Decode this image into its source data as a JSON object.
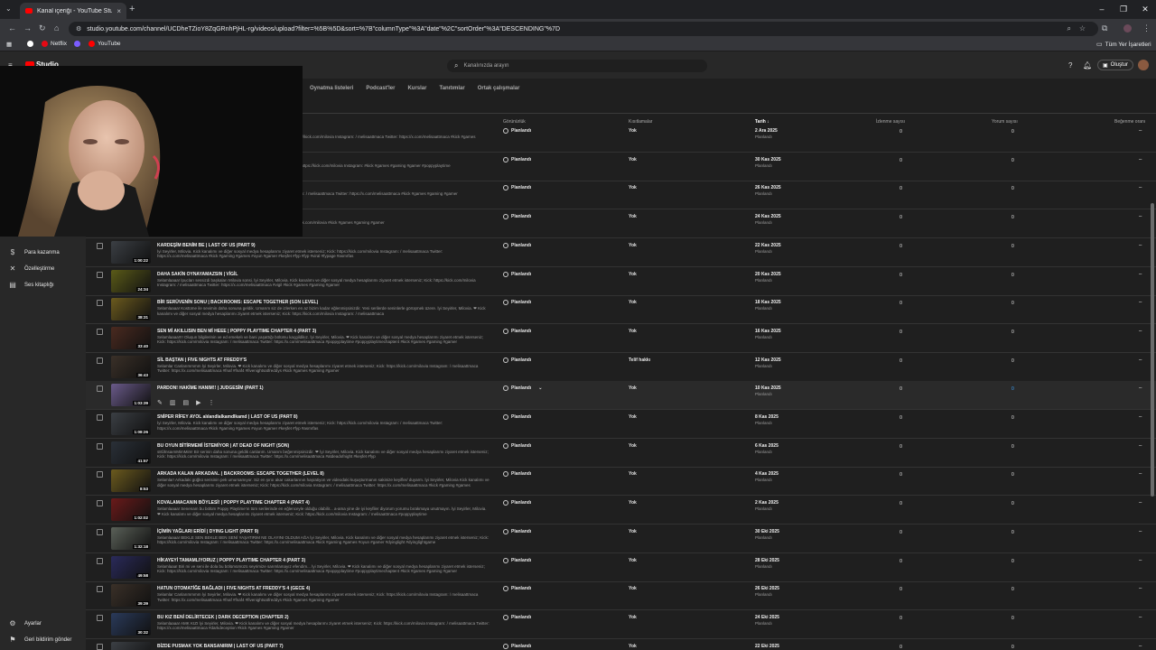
{
  "browser": {
    "tab_title": "Kanal içeriği - YouTube Studio",
    "url": "studio.youtube.com/channel/UCDheTZioY8ZqGRnhPjHL-rg/videos/upload?filter=%5B%5D&sort=%7B\"columnType\"%3A\"date\"%2C\"sortOrder\"%3A\"DESCENDING\"%7D",
    "bookmarks": [
      "Netflix",
      "YouTube"
    ],
    "all_bookmarks": "Tüm Yer İşaretleri"
  },
  "header": {
    "logo": "Studio",
    "search_placeholder": "Kanalınızda arayın",
    "create_label": "Oluştur"
  },
  "sidebar": {
    "items": [
      {
        "label": "Para kazanma",
        "icon": "dollar-icon"
      },
      {
        "label": "Özelleştirme",
        "icon": "brush-icon"
      },
      {
        "label": "Ses kitaplığı",
        "icon": "music-icon"
      }
    ],
    "bottom": [
      {
        "label": "Ayarlar",
        "icon": "gear-icon"
      },
      {
        "label": "Geri bildirim gönder",
        "icon": "feedback-icon"
      }
    ]
  },
  "tabs": [
    "Oynatma listeleri",
    "Podcast'ler",
    "Kurslar",
    "Tanıtımlar",
    "Ortak çalışmalar"
  ],
  "columns": {
    "visibility": "Görünürlük",
    "restrictions": "Kısıtlamalar",
    "date": "Tarih ↓",
    "views": "İzlenme sayısı",
    "comments": "Yorum sayısı",
    "likes": "Beğenme oranı"
  },
  "colors": {
    "accent_blue": "#3ea6ff",
    "bg": "#1f1f1f",
    "sidebar": "#282828"
  },
  "rows": [
    {
      "title": "",
      "desc": "kanalımı ve diğer sosyal medya hesaplarımı ziyaret etmek isterseniz; Kick: https://kick.com/milovia Instagram: / melisaattmaca Twitter: https://x.com/melisaattmaca #kick #games #gaming #gamer",
      "duration": "",
      "visibility": "Planlandı",
      "restriction": "Yok",
      "date": "2 Ara 2025",
      "status": "Planlandı",
      "views": "0",
      "comments": "0",
      "likes": "–",
      "thumb": "#000000"
    },
    {
      "title": "",
      "desc": "Kick kanalımı ve diğer sosyal medya hesaplarımı ziyaret etmek isterseniz; Kick: https://kick.com/milovia Instagram: #kick #games #gaming #gamer #poppyplaytime",
      "duration": "",
      "visibility": "Planlandı",
      "restriction": "Yok",
      "date": "30 Kas 2025",
      "status": "Planlandı",
      "views": "0",
      "comments": "0",
      "likes": "–",
      "thumb": "#000000"
    },
    {
      "title": "",
      "desc": "diya hesaplarımı ziyaret etmek isterseniz; Kick: https://kick.com/milovia Instagram: / melisaattmaca Twitter: https://x.com/melisaattmaca #kick #games #gaming #gamer",
      "duration": "",
      "visibility": "Planlandı",
      "restriction": "Yok",
      "date": "26 Kas 2025",
      "status": "Planlandı",
      "views": "0",
      "comments": "0",
      "likes": "–",
      "thumb": "#000000"
    },
    {
      "title": "",
      "desc": "ialini ve diğer sosyal medya hesaplarımı ziyaret etmek isterseniz; Kick: https://kick.com/milovia #kick #games #gaming #gamer",
      "duration": "",
      "visibility": "Planlandı",
      "restriction": "Yok",
      "date": "24 Kas 2025",
      "status": "Planlandı",
      "views": "0",
      "comments": "0",
      "likes": "–",
      "thumb": "#000000"
    },
    {
      "title": "KARDEŞİM BENİM BE | LAST OF US (PART 9)",
      "desc": "İyi Seyirler, Milovia. Kick kanalımı ve diğer sosyal medya hesaplarımı ziyaret etmek isterseniz; Kick: https://kick.com/milovia Instagram: / melisaattmaca Twitter: https://x.com/melisaattmaca #kick #gaming #games #oyun #gamer #keşfet #fyp #fyp #viral #fypage #asmrfas",
      "duration": "1:00:22",
      "visibility": "Planlandı",
      "restriction": "Yok",
      "date": "22 Kas 2025",
      "status": "Planlandı",
      "views": "0",
      "comments": "0",
      "likes": "–",
      "thumb": "#3b3f44"
    },
    {
      "title": "DAHA SAKİN OYNAYAMAZSIN | VİGİL",
      "desc": "Selamlaaaa! İpucları sessizdi başkaları Milovia sonsi. İyi Seyirler, Milovia. Kick kanalımı ve diğer sosyal medya hesaplarımı ziyaret etmek isterseniz; Kick: https://kick.com/milovia Instagram: / melisaattmaca Twitter: https://x.com/melisaattmaca #vigil #kick #games #gaming #gamer",
      "duration": "24:34",
      "visibility": "Planlandı",
      "restriction": "Yok",
      "date": "20 Kas 2025",
      "status": "Planlandı",
      "views": "0",
      "comments": "0",
      "likes": "–",
      "thumb": "#5a5a18"
    },
    {
      "title": "BİR SERÜVENİN SONU | BACKROOMS: ESCAPE TOGETHER (SON LEVEL)",
      "desc": "Selamlaaaa! Kostüme ile sevimin daha sonuna geldik. Umarım siz de izlerken en az bizim kadar eğlenmişsinizdir. Yeni serilerde seninlerle görüşmek üzere. İyi Seyirler, Milovia. ❤ Kick kanalımı ve diğer sosyal medya hesaplarımı ziyaret etmek isterseniz; Kick: https://kick.com/milovia Instagram: / melisaattmaca",
      "duration": "38:31",
      "visibility": "Planlandı",
      "restriction": "Yok",
      "date": "18 Kas 2025",
      "status": "Planlandı",
      "views": "0",
      "comments": "0",
      "likes": "–",
      "thumb": "#6b5a1e"
    },
    {
      "title": "SEN Mİ AKILLISIN BEN Mİ HEEE | POPPY PLAYTIME CHAPTER 4 (PART 3)",
      "desc": "Selamlaaaa!!!! Oluşun bilgilerinin ve ed emekelı ve bani yaşattığı bölümu kaçgildikız. İyi Seyirler, Milovia. ❤ Kick kanalımı ve diğer sosyal medya hesaplarımı ziyaret etmek isterseniz; Kick: https://kick.com/milovia Instagram: / melisaattmaca Twitter: https://x.com/melisaattmaca #poppyplaytime #poppyplaytimechapter4 #kick #games #gaming #gamer",
      "duration": "33:40",
      "visibility": "Planlandı",
      "restriction": "Yok",
      "date": "16 Kas 2025",
      "status": "Planlandı",
      "views": "0",
      "comments": "0",
      "likes": "–",
      "thumb": "#4a2a20"
    },
    {
      "title": "SİL BAŞTAN | FIVE NIGHTS AT FREDDY'S",
      "desc": "Selamlar Canlarımmmm İyi Seyirler, Milovia. ❤ Kick kanalımı ve diğer sosyal medya hesaplarımı ziyaret etmek isterseniz; Kick: https://kick.com/milovia Instagram: / melisaattmaca Twitter: https://x.com/melisaattmaca #fnaf #fnaf4 #fivenightsatfreddys #kick #games #gaming #gamer",
      "duration": "36:43",
      "visibility": "Planlandı",
      "restriction": "Telif hakkı",
      "date": "12 Kas 2025",
      "status": "Planlandı",
      "views": "0",
      "comments": "0",
      "likes": "–",
      "thumb": "#3a3028"
    },
    {
      "title": "PARDON! HAKİME HANIM!! | JUDGESİM (PART 1)",
      "desc": "",
      "duration": "1:03:39",
      "visibility": "Planlandı",
      "restriction": "Yok",
      "date": "10 Kas 2025",
      "status": "Planlandı",
      "views": "0",
      "comments": "0",
      "likes": "–",
      "thumb": "#6a5a8a",
      "hover": true
    },
    {
      "title": "SNİPER RİFEY AYOL alılandlalkamdlkamd | LAST OF US (PART 8)",
      "desc": "İyi Seyirler, Milovia. Kick kanalımı ve diğer sosyal medya hesaplarımı ziyaret etmek isterseniz; Kick: https://kick.com/milovia Instagram: / melisaattmaca Twitter: https://x.com/melisaattmaca #kick #gaming #games #oyun #gamer #keşfet #fyp #asmrfas",
      "duration": "1:08:26",
      "visibility": "Planlandı",
      "restriction": "Yok",
      "date": "8 Kas 2025",
      "status": "Planlandı",
      "views": "0",
      "comments": "0",
      "likes": "–",
      "thumb": "#3b3f44"
    },
    {
      "title": "BU OYUN BİTİRMEMİ İSTEMİYOR | AT DEAD OF NIGHT (SON)",
      "desc": "s8ÜlnsaımMimMim! Bir serinin daha sonuna geldik canlarım. Umarım beğenmişsinizdir. ❤ İyi Seyirler, Milovia. Kick kanalımı ve diğer sosyal medya hesaplarımı ziyaret etmek isterseniz; Kick: https://kick.com/milovia Instagram: / melisaattmaca Twitter: https://x.com/melisaattmaca #atdeadofnight #keşfet #fyp",
      "duration": "41:57",
      "visibility": "Planlandı",
      "restriction": "Yok",
      "date": "6 Kas 2025",
      "status": "Planlandı",
      "views": "0",
      "comments": "0",
      "likes": "–",
      "thumb": "#2a3038"
    },
    {
      "title": "ARKADA KALAN ARKADAN.. | BACKROOMS: ESCAPE TOGETHER (LEVEL 8)",
      "desc": "Selamlar! Arkadaki güğkü serisinin pek umursamıyor. Siz en şıroı akar cakarlarının haşratiyon ve videodaki kuşuşturmanın sakinize keyifler/ duyarm. İyi Seyirler, Milovia Kick kanalımı ve diğer sosyal medya hesaplarımı ziyaret etmek isterseniz; Kick: https://kick.com/milovia Instagram: / melisaattmaca Twitter: https://x.com/melisaattmaca #kick #gaming #games",
      "duration": "8:53",
      "visibility": "Planlandı",
      "restriction": "Yok",
      "date": "4 Kas 2025",
      "status": "Planlandı",
      "views": "0",
      "comments": "0",
      "likes": "–",
      "thumb": "#6b5a1e"
    },
    {
      "title": "KOVALAMACANIN BÖYLESİ! | POPPY PLAYTIME CHAPTER 4 (PART 4)",
      "desc": "Selamlaaaa! Senenam bu bölüm Poppy Playtime'ın tüm serilerinde en eğlenceyle olduğu olabilir... a-ama yine de iyi keyfiler diyorum yorumu bırakmaya unutmayın. İyi Seyirler, Milovia. ❤ Kick kanalımı ve diğer sosyal medya hesaplarımı ziyaret etmek isterseniz; Kick: https://kick.com/milovia Instagram: / melisaattmaca #poppyplaytime",
      "duration": "1:02:02",
      "visibility": "Planlandı",
      "restriction": "Yok",
      "date": "2 Kas 2025",
      "status": "Planlandı",
      "views": "0",
      "comments": "0",
      "likes": "–",
      "thumb": "#6a1a1a"
    },
    {
      "title": "İÇİMİN YAĞLARI ERİDİ | DYING LIGHT (PART 9)",
      "desc": "Selamlaaaa! BEKLE SEN BEKLE BEN SENİ YAŞATIRIM NE OLAYINI OLDUM AĞA İyi Seyirler, Milovia. Kick kanalımı ve diğer sosyal medya hesaplarımı ziyaret etmek isterseniz; Kick: https://kick.com/milovia Instagram: / melisaattmaca Twitter: https://x.com/melisaattmaca #kick #gaming #games #oyun #gamer #dyinglight #dyinglightgame",
      "duration": "1:32:18",
      "visibility": "Planlandı",
      "restriction": "Yok",
      "date": "30 Eki 2025",
      "status": "Planlandı",
      "views": "0",
      "comments": "0",
      "likes": "–",
      "thumb": "#5a6058"
    },
    {
      "title": "HİKAYEYİ TAMAMLIYORUZ | POPPY PLAYTIME CHAPTER 4 (PART 3)",
      "desc": "Selamlaaa! Biri mi ve seni ile dola bu bölümümüzü seyrimize sarımlamayız efendim... İyi Seyirler, Milovia. ❤ Kick kanalımı ve diğer sosyal medya hesaplarımı ziyaret etmek isterseniz; Kick: https://kick.com/milovia Instagram: / melisaattmaca Twitter: https://x.com/melisaattmaca #poppyplaytime #poppyplaytimechapter4 #kick #games #gaming #gamer",
      "duration": "49:58",
      "visibility": "Planlandı",
      "restriction": "Yok",
      "date": "28 Eki 2025",
      "status": "Planlandı",
      "views": "0",
      "comments": "0",
      "likes": "–",
      "thumb": "#2a2a5a"
    },
    {
      "title": "HATUN OTOMATİĞE BAĞLADI | FIVE NIGHTS AT FREDDY'S 4 (GECE 4)",
      "desc": "Selamlar Canlarımmmm İyi Seyirler, Milovia. ❤ Kick kanalımı ve diğer sosyal medya hesaplarımı ziyaret etmek isterseniz; Kick: https://kick.com/milovia Instagram: / melisaattmaca Twitter: https://x.com/melisaattmaca #fnaf #fnaf4 #fivenightsatfreddys #kick #games #gaming #gamer",
      "duration": "39:39",
      "visibility": "Planlandı",
      "restriction": "Yok",
      "date": "26 Eki 2025",
      "status": "Planlandı",
      "views": "0",
      "comments": "0",
      "likes": "–",
      "thumb": "#3a3028"
    },
    {
      "title": "BU KIZ BENİ DELİRTECEK | DARK DECEPTION (CHAPTER 2)",
      "desc": "Selamlaaaa! AMK KIZI İyi Seyirler, Milovia. ❤ Kick kanalımı ve diğer sosyal medya hesaplarımı ziyaret etmek isterseniz; Kick: https://kick.com/milovia Instagram: / melisaattmaca Twitter: https://x.com/melisaattmaca #darkdeception #kick #games #gaming #gamer",
      "duration": "30:32",
      "visibility": "Planlandı",
      "restriction": "Yok",
      "date": "24 Eki 2025",
      "status": "Planlandı",
      "views": "0",
      "comments": "0",
      "likes": "–",
      "thumb": "#2a3a5a"
    },
    {
      "title": "BİZDE PUSMAK YOK BANSANIRIM | LAST OF US (PART 7)",
      "desc": "",
      "duration": "",
      "visibility": "Planlandı",
      "restriction": "Yok",
      "date": "22 Eki 2025",
      "status": "Planlandı",
      "views": "0",
      "comments": "0",
      "likes": "–",
      "thumb": "#3b3f44"
    }
  ]
}
